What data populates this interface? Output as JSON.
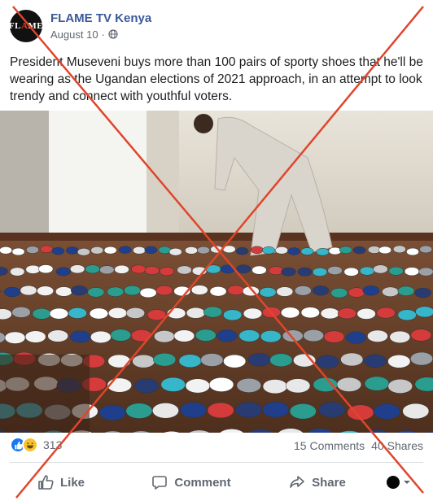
{
  "post": {
    "page_name": "FLAME TV Kenya",
    "avatar_text_left": "FL",
    "avatar_text_mid": "A",
    "avatar_text_right": "ME",
    "time": "August 10",
    "time_sep": "·",
    "caption": "President Museveni buys more than 100 pairs of sporty shoes that he'll be wearing as the Ugandan elections of 2021 approach, in an attempt to look trendy and connect with youthful voters."
  },
  "engagement": {
    "reaction_count": "313",
    "comments": "15 Comments",
    "shares": "40 Shares"
  },
  "actions": {
    "like": "Like",
    "comment": "Comment",
    "share": "Share"
  },
  "colors": {
    "brand_blue": "#3b5998",
    "cross_red": "#e0452b",
    "like_blue": "#1877f2"
  },
  "icons": [
    "globe-icon",
    "like-reaction-icon",
    "haha-reaction-icon",
    "thumbs-up-icon",
    "comment-icon",
    "share-icon",
    "caret-down-icon"
  ]
}
